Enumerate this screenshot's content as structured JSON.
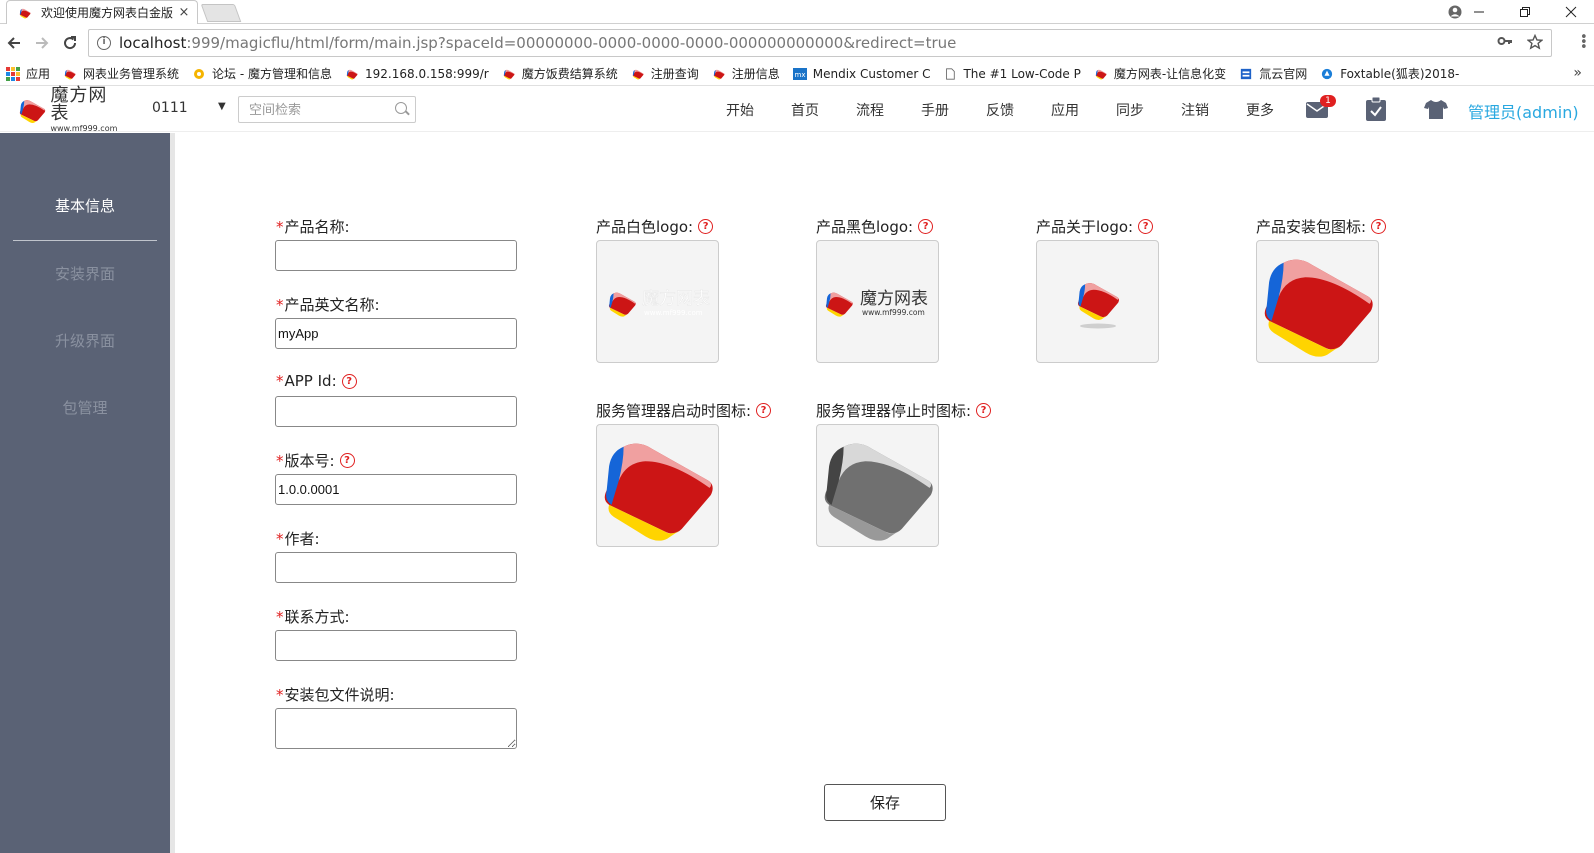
{
  "browser": {
    "tab_title": "欢迎使用魔方网表白金版",
    "tab_close": "×",
    "url_host": "localhost",
    "url_rest": ":999/magicflu/html/form/main.jsp?spaceId=00000000-0000-0000-0000-000000000000&redirect=true",
    "bookmarks": [
      "应用",
      "网表业务管理系统",
      "论坛 - 魔方管理和信息",
      "192.168.0.158:999/r",
      "魔方饭费结算系统",
      "注册查询",
      "注册信息",
      "Mendix Customer C",
      "The #1 Low-Code P",
      "魔方网表-让信息化变",
      "氚云官网",
      "Foxtable(狐表)2018-"
    ],
    "bookmarks_more": "»"
  },
  "header": {
    "logo_cn": "魔方网表",
    "logo_url": "www.mf999.com",
    "space": "0111",
    "search_placeholder": "空间检索",
    "nav": [
      "开始",
      "首页",
      "流程",
      "手册",
      "反馈",
      "应用",
      "同步",
      "注销",
      "更多"
    ],
    "mail_badge": "1",
    "admin": "管理员(admin)"
  },
  "sidebar": {
    "items": [
      "基本信息",
      "安装界面",
      "升级界面",
      "包管理"
    ]
  },
  "form": {
    "required_mark": "*",
    "help_mark": "?",
    "fields": [
      {
        "label": "产品名称:",
        "value": ""
      },
      {
        "label": "产品英文名称:",
        "value": "myApp"
      },
      {
        "label": "APP Id:",
        "value": ""
      },
      {
        "label": "版本号:",
        "value": "1.0.0.0001"
      },
      {
        "label": "作者:",
        "value": ""
      },
      {
        "label": "联系方式:",
        "value": ""
      },
      {
        "label": "安装包文件说明:",
        "value": ""
      }
    ],
    "images": [
      {
        "label": "产品白色logo:",
        "text_cn": "魔方网表",
        "text_url": "www.mf999.com"
      },
      {
        "label": "产品黑色logo:",
        "text_cn": "魔方网表",
        "text_url": "www.mf999.com"
      },
      {
        "label": "产品关于logo:"
      },
      {
        "label": "产品安装包图标:"
      },
      {
        "label": "服务管理器启动时图标:"
      },
      {
        "label": "服务管理器停止时图标:"
      }
    ],
    "save_label": "保存"
  },
  "colors": {
    "sidebar_bg": "#5a6275",
    "accent": "#29a8e0",
    "required": "#e02020",
    "logo_red": "#d42020",
    "logo_blue": "#1565d8",
    "logo_yellow": "#ffd400"
  }
}
